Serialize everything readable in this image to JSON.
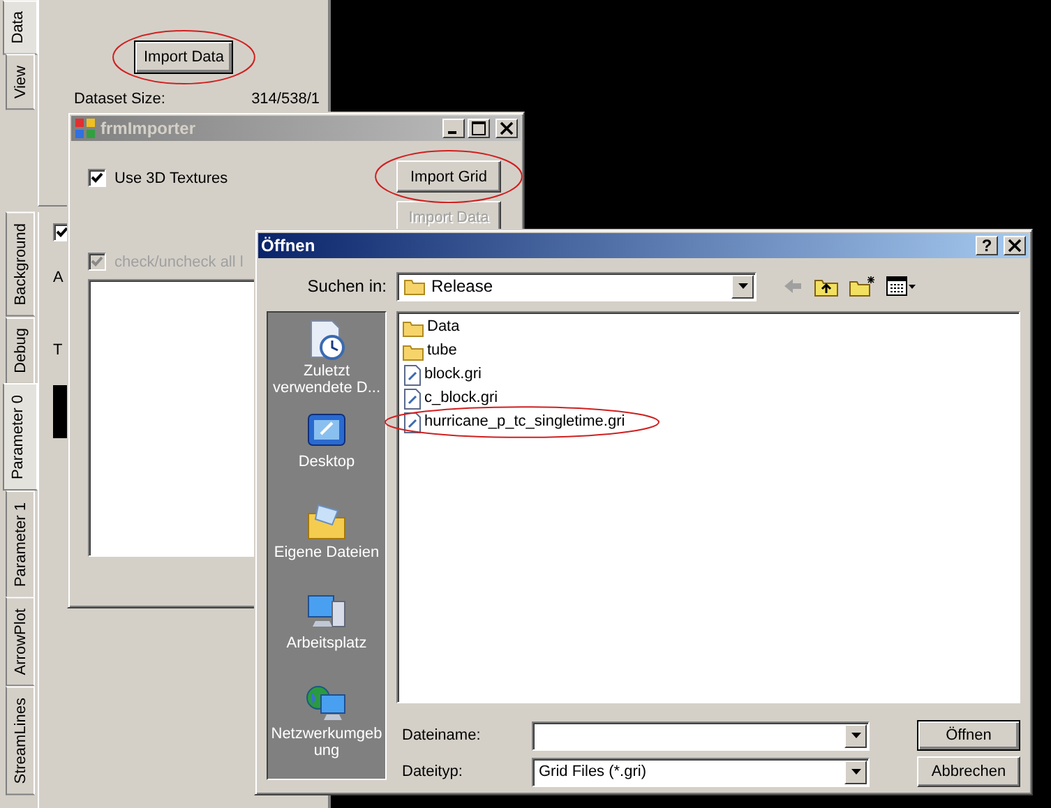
{
  "main_window": {
    "side_tabs_top": [
      {
        "label": "Data",
        "selected": true
      },
      {
        "label": "View",
        "selected": false
      }
    ],
    "side_tabs_bottom": [
      {
        "label": "Background",
        "selected": false
      },
      {
        "label": "Debug",
        "selected": false
      },
      {
        "label": "Parameter 0",
        "selected": true
      },
      {
        "label": "Parameter 1",
        "selected": false
      },
      {
        "label": "ArrowPlot",
        "selected": false
      },
      {
        "label": "StreamLines",
        "selected": false
      }
    ],
    "data_panel": {
      "import_button": {
        "label": "Import Data",
        "circled": true
      },
      "dataset_size_label": "Dataset Size:",
      "dataset_size_value": "314/538/1"
    },
    "parameter_panel": {
      "checkbox_checked": true,
      "label_1": "A",
      "label_2": "T"
    }
  },
  "importer_window": {
    "title": "frmImporter",
    "use_3d_textures": {
      "label": "Use 3D Textures",
      "checked": true
    },
    "import_grid_button": {
      "label": "Import Grid",
      "circled": true,
      "disabled": false
    },
    "import_data_button": {
      "label": "Import Data",
      "disabled": true
    },
    "check_all": {
      "label": "check/uncheck all l",
      "checked": true,
      "disabled": true
    }
  },
  "open_dialog": {
    "title": "Öffnen",
    "help_button": "?",
    "look_in_label": "Suchen in:",
    "look_in_value": "Release",
    "places": [
      {
        "label": "Zuletzt verwendete D...",
        "kind": "recent"
      },
      {
        "label": "Desktop",
        "kind": "desktop"
      },
      {
        "label": "Eigene Dateien",
        "kind": "documents"
      },
      {
        "label": "Arbeitsplatz",
        "kind": "computer"
      },
      {
        "label": "Netzwerkumgeb ung",
        "kind": "network"
      }
    ],
    "files": [
      {
        "name": "Data",
        "kind": "folder",
        "circled": false
      },
      {
        "name": "tube",
        "kind": "folder",
        "circled": false
      },
      {
        "name": "block.gri",
        "kind": "file",
        "circled": false
      },
      {
        "name": "c_block.gri",
        "kind": "file",
        "circled": false
      },
      {
        "name": "hurricane_p_tc_singletime.gri",
        "kind": "file",
        "circled": true
      }
    ],
    "filename_label": "Dateiname:",
    "filetype_label": "Dateityp:",
    "filetype_value": "Grid Files (*.gri)",
    "buttons": [
      {
        "label": "Öffnen",
        "default": true
      },
      {
        "label": "Abbrechen",
        "default": false
      }
    ]
  }
}
